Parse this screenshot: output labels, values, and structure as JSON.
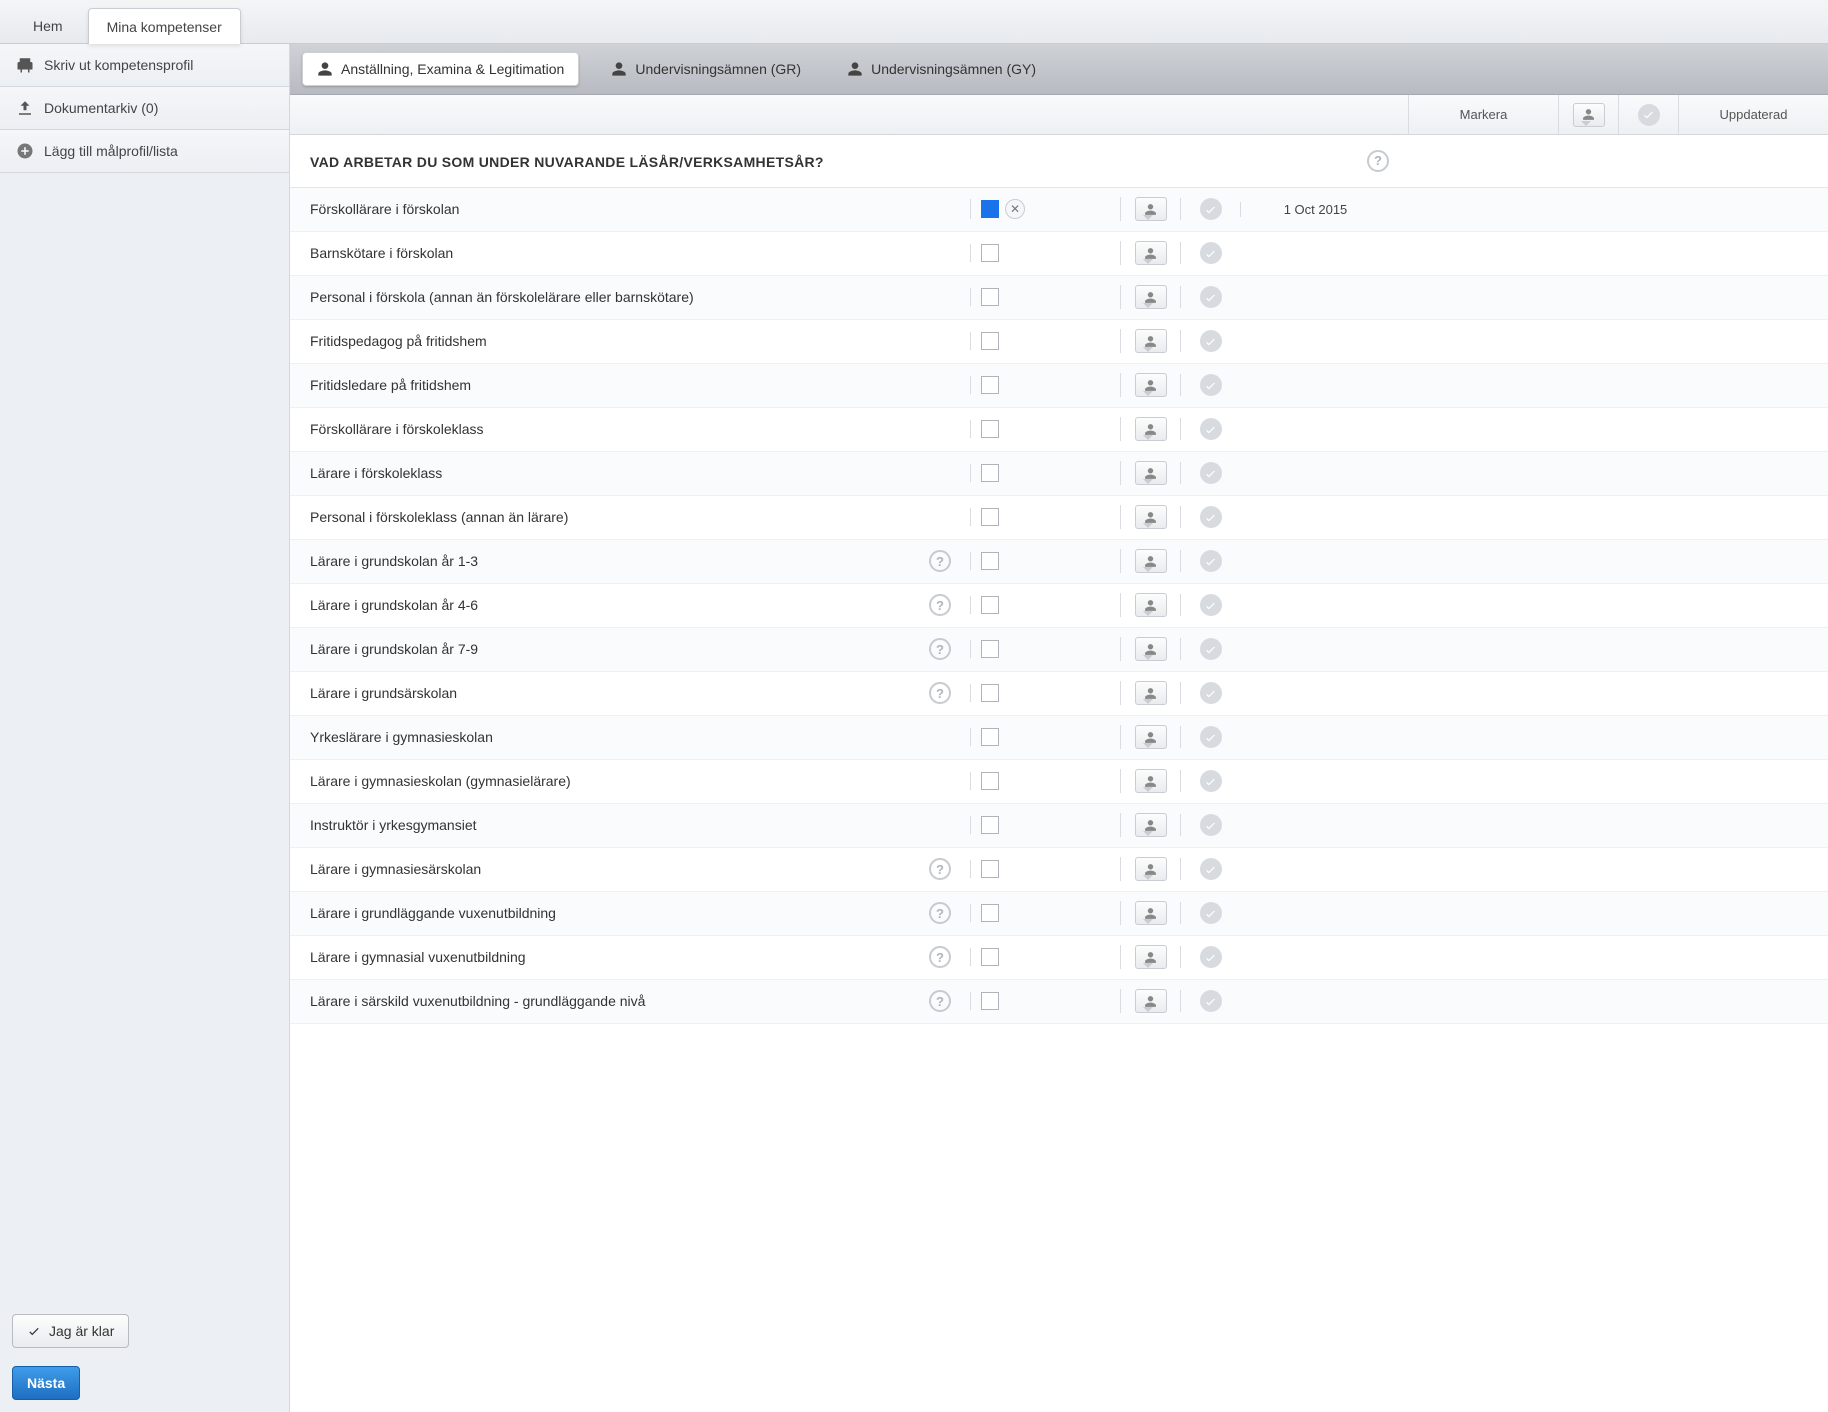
{
  "topnav": {
    "tabs": [
      {
        "label": "Hem",
        "active": false
      },
      {
        "label": "Mina kompetenser",
        "active": true
      }
    ]
  },
  "sidebar": {
    "items": [
      {
        "icon": "print",
        "label": "Skriv ut kompetensprofil"
      },
      {
        "icon": "upload",
        "label": "Dokumentarkiv (0)"
      },
      {
        "icon": "plus",
        "label": "Lägg till målprofil/lista"
      }
    ],
    "done_label": "Jag är klar",
    "next_label": "Nästa"
  },
  "section_tabs": [
    {
      "label": "Anställning, Examina & Legitimation",
      "active": true
    },
    {
      "label": "Undervisningsämnen (GR)",
      "active": false
    },
    {
      "label": "Undervisningsämnen (GY)",
      "active": false
    }
  ],
  "cols": {
    "mark": "Markera",
    "updated": "Uppdaterad"
  },
  "question": "VAD ARBETAR DU SOM UNDER NUVARANDE LÄSÅR/VERKSAMHETSÅR?",
  "rows": [
    {
      "label": "Förskollärare i förskolan",
      "help": false,
      "checked": true,
      "clearable": true,
      "updated": "1 Oct 2015"
    },
    {
      "label": "Barnskötare i förskolan",
      "help": false,
      "checked": false,
      "updated": ""
    },
    {
      "label": "Personal i förskola (annan än förskolelärare eller barnskötare)",
      "help": false,
      "checked": false,
      "updated": ""
    },
    {
      "label": "Fritidspedagog på fritidshem",
      "help": false,
      "checked": false,
      "updated": ""
    },
    {
      "label": "Fritidsledare på fritidshem",
      "help": false,
      "checked": false,
      "updated": ""
    },
    {
      "label": "Förskollärare i förskoleklass",
      "help": false,
      "checked": false,
      "updated": ""
    },
    {
      "label": "Lärare i förskoleklass",
      "help": false,
      "checked": false,
      "updated": ""
    },
    {
      "label": "Personal i förskoleklass (annan än lärare)",
      "help": false,
      "checked": false,
      "updated": ""
    },
    {
      "label": "Lärare i grundskolan år 1-3",
      "help": true,
      "checked": false,
      "updated": ""
    },
    {
      "label": "Lärare i grundskolan år 4-6",
      "help": true,
      "checked": false,
      "updated": ""
    },
    {
      "label": "Lärare i grundskolan år 7-9",
      "help": true,
      "checked": false,
      "updated": ""
    },
    {
      "label": "Lärare i grundsärskolan",
      "help": true,
      "checked": false,
      "updated": ""
    },
    {
      "label": "Yrkeslärare i gymnasieskolan",
      "help": false,
      "checked": false,
      "updated": ""
    },
    {
      "label": "Lärare i gymnasieskolan (gymnasielärare)",
      "help": false,
      "checked": false,
      "updated": ""
    },
    {
      "label": "Instruktör i yrkesgymansiet",
      "help": false,
      "checked": false,
      "updated": ""
    },
    {
      "label": "Lärare i gymnasiesärskolan",
      "help": true,
      "checked": false,
      "updated": ""
    },
    {
      "label": "Lärare i grundläggande vuxenutbildning",
      "help": true,
      "checked": false,
      "updated": ""
    },
    {
      "label": "Lärare i gymnasial vuxenutbildning",
      "help": true,
      "checked": false,
      "updated": ""
    },
    {
      "label": "Lärare i särskild vuxenutbildning - grundläggande nivå",
      "help": true,
      "checked": false,
      "updated": ""
    }
  ]
}
